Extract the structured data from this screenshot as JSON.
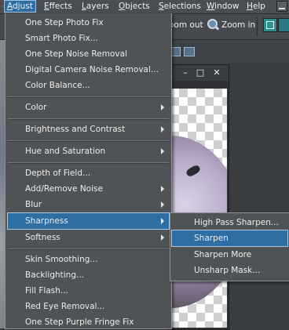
{
  "menubar": {
    "items": [
      {
        "prefix": "",
        "underline": "A",
        "rest": "djust"
      },
      {
        "prefix": "",
        "underline": "E",
        "rest": "ffects"
      },
      {
        "prefix": "",
        "underline": "L",
        "rest": "ayers"
      },
      {
        "prefix": "",
        "underline": "O",
        "rest": "bjects"
      },
      {
        "prefix": "",
        "underline": "S",
        "rest": "elections"
      },
      {
        "prefix": "",
        "underline": "W",
        "rest": "indow"
      },
      {
        "prefix": "",
        "underline": "H",
        "rest": "elp"
      }
    ]
  },
  "toolbar": {
    "zoom_out_label": "oom out",
    "zoom_in_label": "Zoom in"
  },
  "document_window": {
    "minimize": "–",
    "maximize": "□",
    "close": "✕"
  },
  "adjust_menu": {
    "items": [
      {
        "label": "One Step Photo Fix",
        "submenu": false
      },
      {
        "label": "Smart Photo Fix...",
        "submenu": false
      },
      {
        "label": "One Step Noise Removal",
        "submenu": false
      },
      {
        "label": "Digital Camera Noise Removal...",
        "submenu": false
      },
      {
        "label": "Color Balance...",
        "submenu": false
      },
      {
        "label": "Color",
        "submenu": true
      },
      {
        "label": "Brightness and Contrast",
        "submenu": true
      },
      {
        "label": "Hue and Saturation",
        "submenu": true
      },
      {
        "label": "Depth of Field...",
        "submenu": false
      },
      {
        "label": "Add/Remove Noise",
        "submenu": true
      },
      {
        "label": "Blur",
        "submenu": true
      },
      {
        "label": "Sharpness",
        "submenu": true
      },
      {
        "label": "Softness",
        "submenu": true
      },
      {
        "label": "Skin Smoothing...",
        "submenu": false
      },
      {
        "label": "Backlighting...",
        "submenu": false
      },
      {
        "label": "Fill Flash...",
        "submenu": false
      },
      {
        "label": "Red Eye Removal...",
        "submenu": false
      },
      {
        "label": "One Step Purple Fringe Fix",
        "submenu": false
      }
    ]
  },
  "sharpness_submenu": {
    "items": [
      {
        "label": "High Pass Sharpen..."
      },
      {
        "label": "Sharpen"
      },
      {
        "label": "Sharpen More"
      },
      {
        "label": "Unsharp Mask..."
      }
    ]
  },
  "colors": {
    "highlight": "#2f6ea3",
    "menu_bg": "#505356",
    "text": "#ececec"
  }
}
